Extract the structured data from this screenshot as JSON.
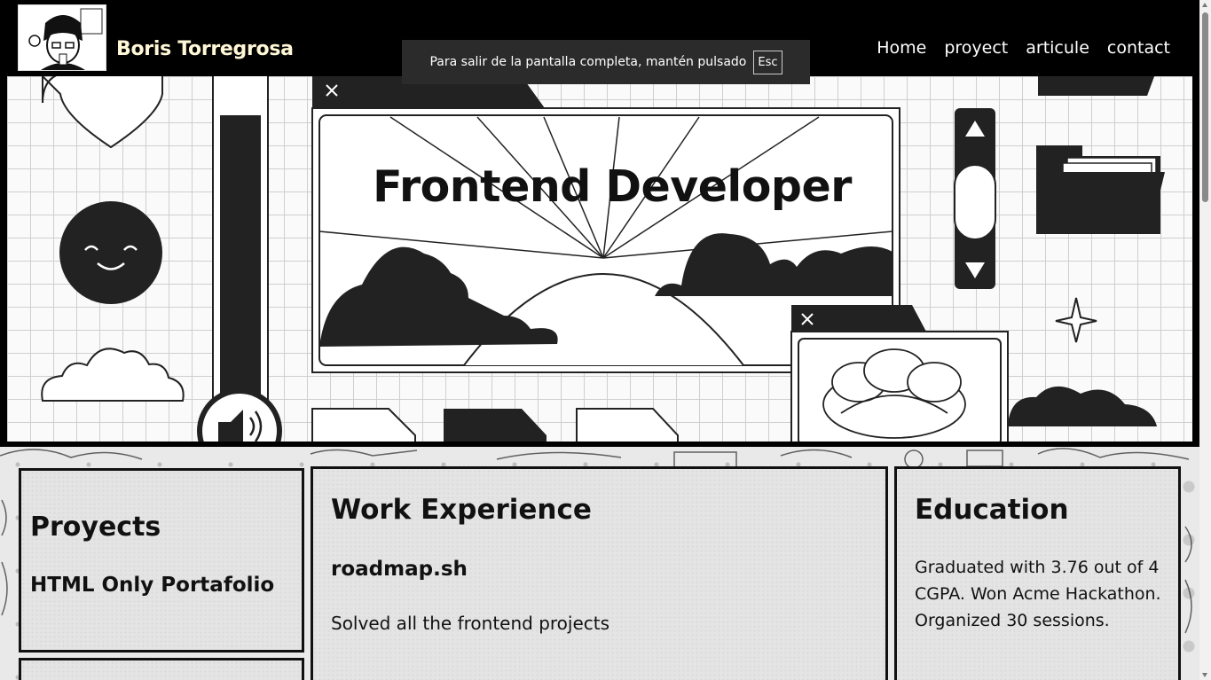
{
  "header": {
    "brand": "Boris Torregrosa",
    "logo_icon": "avatar-portrait-icon",
    "nav": [
      {
        "label": "Home"
      },
      {
        "label": "proyect"
      },
      {
        "label": "articule"
      },
      {
        "label": "contact"
      }
    ]
  },
  "fullscreen_notice": {
    "text": "Para salir de la pantalla completa, mantén pulsado",
    "key": "Esc"
  },
  "hero": {
    "title": "Frontend Developer",
    "icons": [
      "heart-icon",
      "smiley-icon",
      "cloud-icon",
      "speaker-icon",
      "close-icon",
      "arrow-up-icon",
      "arrow-down-icon",
      "folder-icon",
      "sparkle-icon",
      "flower-icon",
      "document-icon"
    ]
  },
  "sections": {
    "projects": {
      "heading": "Proyects",
      "item": "HTML Only Portafolio"
    },
    "work": {
      "heading": "Work Experience",
      "company": "roadmap.sh",
      "description": "Solved all the frontend projects"
    },
    "education": {
      "heading": "Education",
      "description": "Graduated with 3.76 out of 4 CGPA. Won Acme Hackathon. Organized 30 sessions."
    }
  },
  "colors": {
    "header_bg": "#000000",
    "brand_color": "#fff7d6",
    "card_bg": "#e4e4e4",
    "ink": "#111111"
  }
}
